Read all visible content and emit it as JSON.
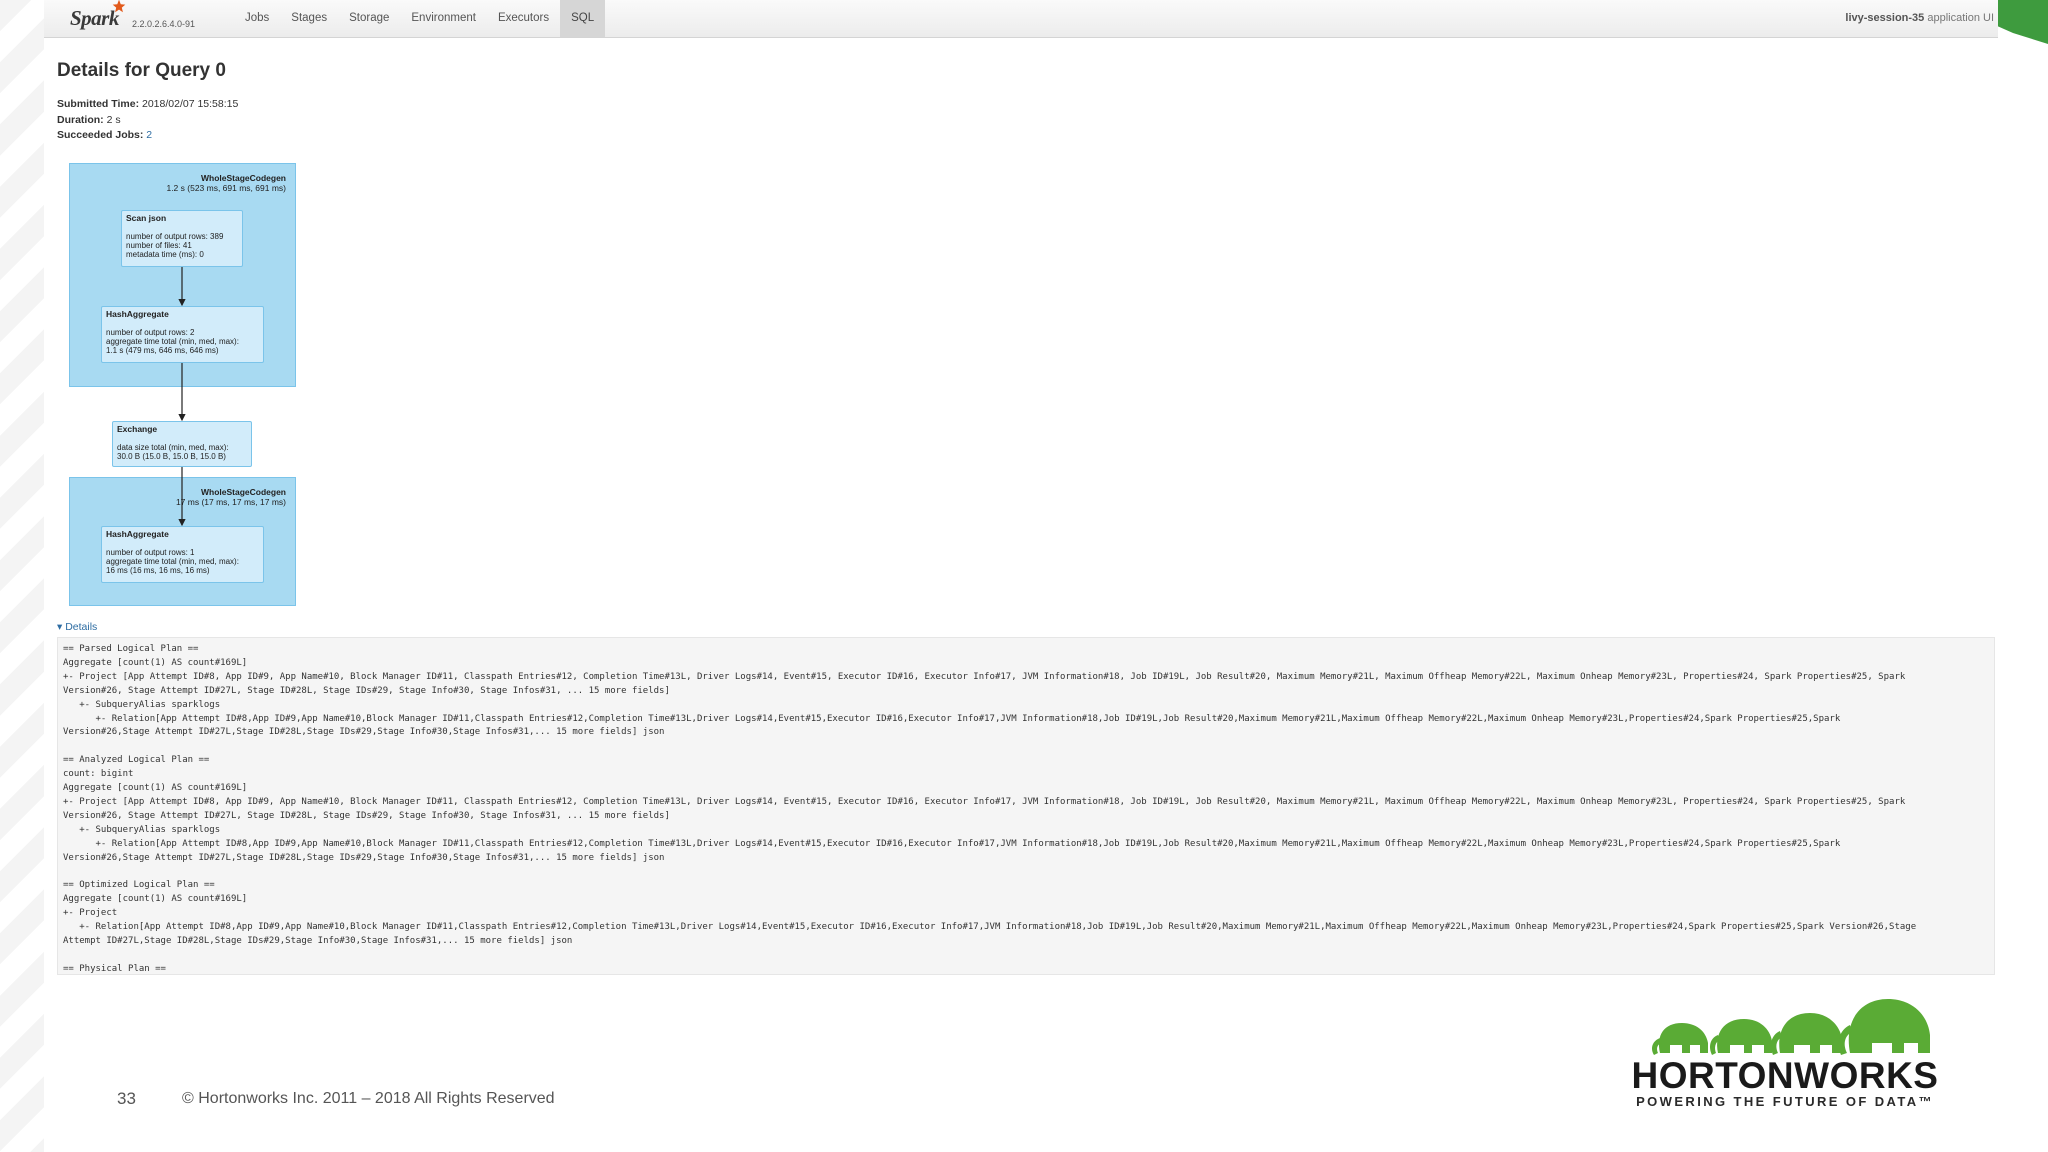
{
  "navbar": {
    "brand": "Spark",
    "version": "2.2.0.2.6.4.0-91",
    "tabs": [
      "Jobs",
      "Stages",
      "Storage",
      "Environment",
      "Executors",
      "SQL"
    ],
    "active_tab": "SQL",
    "session": "livy-session-35",
    "app_label": "application UI"
  },
  "page": {
    "title": "Details for Query 0",
    "submitted_label": "Submitted Time:",
    "submitted_value": "2018/02/07 15:58:15",
    "duration_label": "Duration:",
    "duration_value": "2 s",
    "jobs_label": "Succeeded Jobs:",
    "jobs_value": "2"
  },
  "dag": {
    "cluster1": {
      "title": "WholeStageCodegen",
      "metric": "1.2 s (523 ms, 691 ms, 691 ms)"
    },
    "scan": {
      "title": "Scan json",
      "lines": [
        "number of output rows: 389",
        "number of files: 41",
        "metadata time (ms): 0"
      ]
    },
    "hash1": {
      "title": "HashAggregate",
      "lines": [
        "number of output rows: 2",
        "aggregate time total (min, med, max):",
        "1.1 s (479 ms, 646 ms, 646 ms)"
      ]
    },
    "exchange": {
      "title": "Exchange",
      "lines": [
        "data size total (min, med, max):",
        "30.0 B (15.0 B, 15.0 B, 15.0 B)"
      ]
    },
    "cluster2": {
      "title": "WholeStageCodegen",
      "metric": "17 ms (17 ms, 17 ms, 17 ms)"
    },
    "hash2": {
      "title": "HashAggregate",
      "lines": [
        "number of output rows: 1",
        "aggregate time total (min, med, max):",
        "16 ms (16 ms, 16 ms, 16 ms)"
      ]
    }
  },
  "details": {
    "toggle_label": "Details",
    "plan_lines": [
      "== Parsed Logical Plan ==",
      "Aggregate [count(1) AS count#169L]",
      "+- Project [App Attempt ID#8, App ID#9, App Name#10, Block Manager ID#11, Classpath Entries#12, Completion Time#13L, Driver Logs#14, Event#15, Executor ID#16, Executor Info#17, JVM Information#18, Job ID#19L, Job Result#20, Maximum Memory#21L, Maximum Offheap Memory#22L, Maximum Onheap Memory#23L, Properties#24, Spark Properties#25, Spark",
      "Version#26, Stage Attempt ID#27L, Stage ID#28L, Stage IDs#29, Stage Info#30, Stage Infos#31, ... 15 more fields]",
      "   +- SubqueryAlias sparklogs",
      "      +- Relation[App Attempt ID#8,App ID#9,App Name#10,Block Manager ID#11,Classpath Entries#12,Completion Time#13L,Driver Logs#14,Event#15,Executor ID#16,Executor Info#17,JVM Information#18,Job ID#19L,Job Result#20,Maximum Memory#21L,Maximum Offheap Memory#22L,Maximum Onheap Memory#23L,Properties#24,Spark Properties#25,Spark",
      "Version#26,Stage Attempt ID#27L,Stage ID#28L,Stage IDs#29,Stage Info#30,Stage Infos#31,... 15 more fields] json",
      "",
      "== Analyzed Logical Plan ==",
      "count: bigint",
      "Aggregate [count(1) AS count#169L]",
      "+- Project [App Attempt ID#8, App ID#9, App Name#10, Block Manager ID#11, Classpath Entries#12, Completion Time#13L, Driver Logs#14, Event#15, Executor ID#16, Executor Info#17, JVM Information#18, Job ID#19L, Job Result#20, Maximum Memory#21L, Maximum Offheap Memory#22L, Maximum Onheap Memory#23L, Properties#24, Spark Properties#25, Spark",
      "Version#26, Stage Attempt ID#27L, Stage ID#28L, Stage IDs#29, Stage Info#30, Stage Infos#31, ... 15 more fields]",
      "   +- SubqueryAlias sparklogs",
      "      +- Relation[App Attempt ID#8,App ID#9,App Name#10,Block Manager ID#11,Classpath Entries#12,Completion Time#13L,Driver Logs#14,Event#15,Executor ID#16,Executor Info#17,JVM Information#18,Job ID#19L,Job Result#20,Maximum Memory#21L,Maximum Offheap Memory#22L,Maximum Onheap Memory#23L,Properties#24,Spark Properties#25,Spark",
      "Version#26,Stage Attempt ID#27L,Stage ID#28L,Stage IDs#29,Stage Info#30,Stage Infos#31,... 15 more fields] json",
      "",
      "== Optimized Logical Plan ==",
      "Aggregate [count(1) AS count#169L]",
      "+- Project",
      "   +- Relation[App Attempt ID#8,App ID#9,App Name#10,Block Manager ID#11,Classpath Entries#12,Completion Time#13L,Driver Logs#14,Event#15,Executor ID#16,Executor Info#17,JVM Information#18,Job ID#19L,Job Result#20,Maximum Memory#21L,Maximum Offheap Memory#22L,Maximum Onheap Memory#23L,Properties#24,Spark Properties#25,Spark Version#26,Stage",
      "Attempt ID#27L,Stage ID#28L,Stage IDs#29,Stage Info#30,Stage Infos#31,... 15 more fields] json",
      "",
      "== Physical Plan =="
    ]
  },
  "footer": {
    "slide_number": "33",
    "copyright": "© Hortonworks Inc. 2011 – 2018  All Rights Reserved",
    "logo_name": "HORTONWORKS",
    "logo_tagline": "POWERING THE FUTURE OF DATA™"
  },
  "colors": {
    "cluster_fill": "#a8daf2",
    "node_fill": "#d2ecfa",
    "link": "#2d6ca2",
    "brand_green": "#3e9b3e"
  }
}
